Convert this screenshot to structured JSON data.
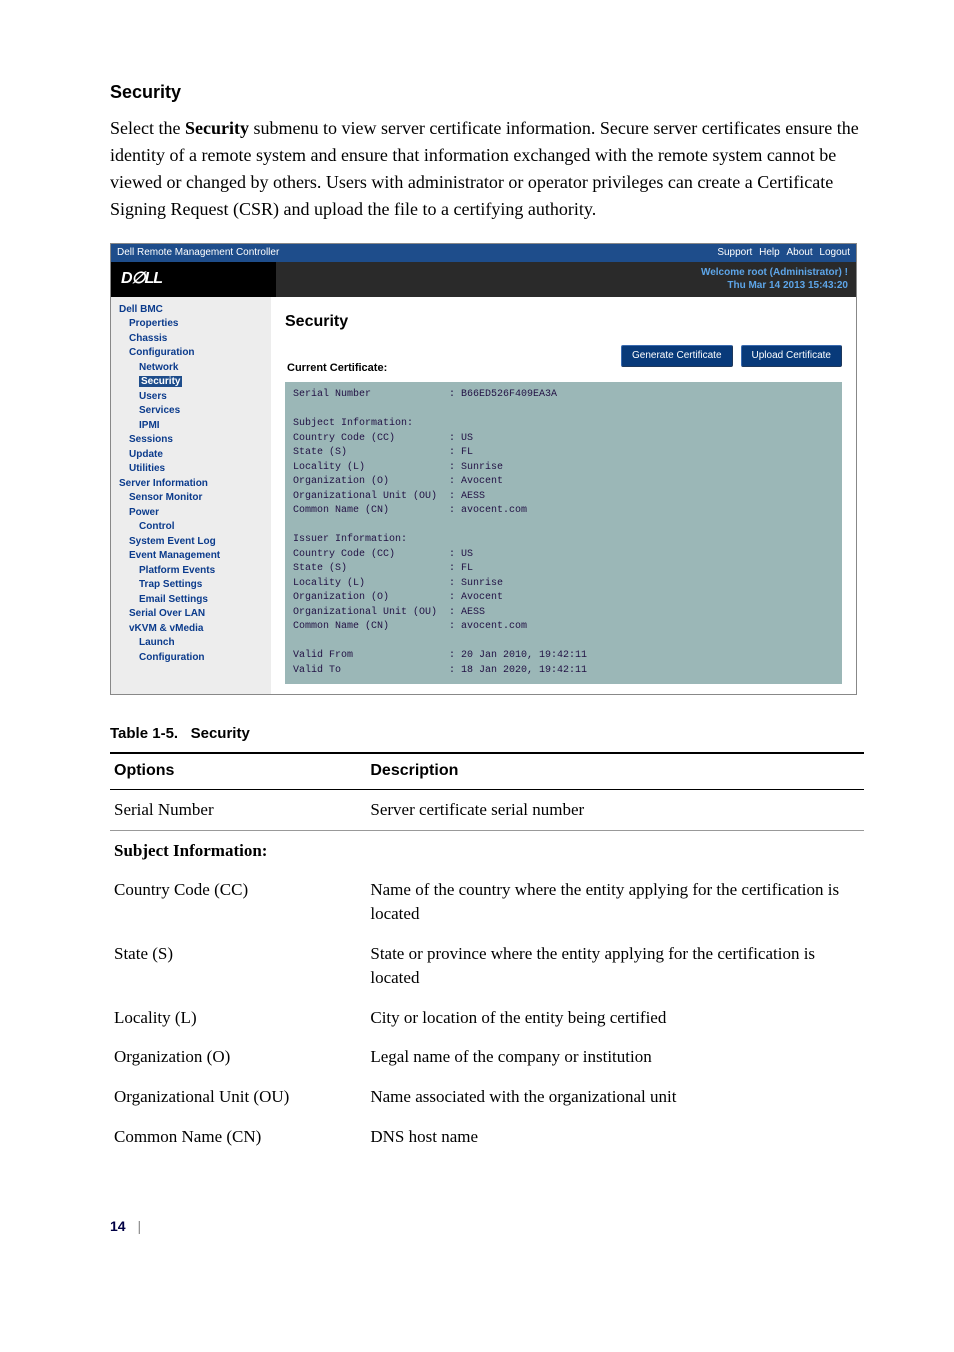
{
  "section": {
    "title": "Security",
    "paragraph_prefix": "Select the ",
    "paragraph_bold": "Security",
    "paragraph_rest": " submenu to view server certificate information. Secure server certificates ensure the identity of a remote system and ensure that information exchanged with the remote system cannot be viewed or changed by others. Users with administrator or operator privileges can create a Certificate Signing Request (CSR) and upload the file to a certifying authority."
  },
  "screenshot": {
    "titlebar_left": "Dell Remote Management Controller",
    "titlebar_links": [
      "Support",
      "Help",
      "About",
      "Logout"
    ],
    "logo_text": "D∅LL",
    "welcome_line1": "Welcome root (Administrator) !",
    "welcome_line2": "Thu Mar 14 2013 15:43:20",
    "nav": [
      {
        "cls": "lvl1",
        "text": "Dell BMC"
      },
      {
        "cls": "lvl2",
        "text": "Properties"
      },
      {
        "cls": "lvl2",
        "text": "Chassis"
      },
      {
        "cls": "lvl2",
        "text": "Configuration"
      },
      {
        "cls": "lvl3",
        "text": "Network"
      },
      {
        "cls": "lvl3 selected",
        "text": "Security"
      },
      {
        "cls": "lvl3",
        "text": "Users"
      },
      {
        "cls": "lvl3",
        "text": "Services"
      },
      {
        "cls": "lvl3",
        "text": "IPMI"
      },
      {
        "cls": "lvl2",
        "text": "Sessions"
      },
      {
        "cls": "lvl2",
        "text": "Update"
      },
      {
        "cls": "lvl2",
        "text": "Utilities"
      },
      {
        "cls": "lvl1",
        "text": "Server Information"
      },
      {
        "cls": "lvl2",
        "text": "Sensor Monitor"
      },
      {
        "cls": "lvl2",
        "text": "Power"
      },
      {
        "cls": "lvl3",
        "text": "Control"
      },
      {
        "cls": "lvl2",
        "text": "System Event Log"
      },
      {
        "cls": "lvl2",
        "text": "Event Management"
      },
      {
        "cls": "lvl3",
        "text": "Platform Events"
      },
      {
        "cls": "lvl3",
        "text": "Trap Settings"
      },
      {
        "cls": "lvl3",
        "text": "Email Settings"
      },
      {
        "cls": "lvl2",
        "text": "Serial Over LAN"
      },
      {
        "cls": "lvl2",
        "text": "vKVM & vMedia"
      },
      {
        "cls": "lvl3",
        "text": "Launch"
      },
      {
        "cls": "lvl3",
        "text": "Configuration"
      }
    ],
    "main_heading": "Security",
    "btn_generate": "Generate Certificate",
    "btn_upload": "Upload Certificate",
    "cert_label": "Current Certificate:",
    "cert_text": "Serial Number             : B66ED526F409EA3A\n\nSubject Information:\nCountry Code (CC)         : US\nState (S)                 : FL\nLocality (L)              : Sunrise\nOrganization (O)          : Avocent\nOrganizational Unit (OU)  : AESS\nCommon Name (CN)          : avocent.com\n\nIssuer Information:\nCountry Code (CC)         : US\nState (S)                 : FL\nLocality (L)              : Sunrise\nOrganization (O)          : Avocent\nOrganizational Unit (OU)  : AESS\nCommon Name (CN)          : avocent.com\n\nValid From                : 20 Jan 2010, 19:42:11\nValid To                  : 18 Jan 2020, 19:42:11"
  },
  "table": {
    "caption_prefix": "Table 1-5.",
    "caption_title": "Security",
    "head_options": "Options",
    "head_description": "Description",
    "rows": [
      {
        "opt": "Serial Number",
        "desc": "Server certificate serial number"
      },
      {
        "opt": "Subject Information:",
        "desc": "",
        "bold": true
      },
      {
        "opt": "Country Code (CC)",
        "desc": "Name of the country where the entity applying for the certification is located"
      },
      {
        "opt": "State (S)",
        "desc": "State or province where the entity applying for the certification is located"
      },
      {
        "opt": "Locality (L)",
        "desc": "City or location of the entity being certified"
      },
      {
        "opt": "Organization (O)",
        "desc": "Legal name of the company or institution"
      },
      {
        "opt": "Organizational Unit (OU)",
        "desc": "Name associated with the organizational unit"
      },
      {
        "opt": "Common Name (CN)",
        "desc": "DNS host name"
      }
    ]
  },
  "footer": {
    "page": "14",
    "sep": "|"
  }
}
